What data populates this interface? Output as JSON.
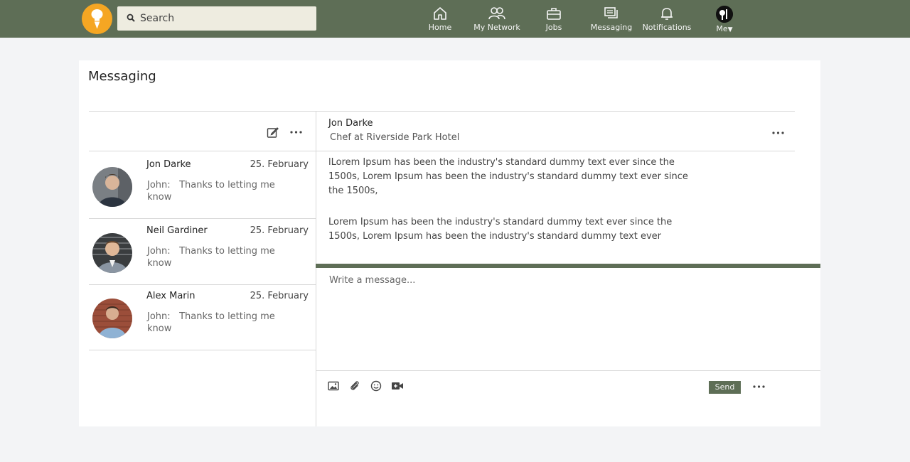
{
  "colors": {
    "accent": "#5e6e56",
    "logo": "#f5a623",
    "search_bg": "#eeece0"
  },
  "search": {
    "placeholder": "Search"
  },
  "nav": {
    "home": "Home",
    "network": "My Network",
    "jobs": "Jobs",
    "messaging": "Messaging",
    "notifications": "Notifications",
    "me": "Me"
  },
  "page": {
    "title": "Messaging"
  },
  "conversations": [
    {
      "name": "Jon Darke",
      "date": "25. February",
      "preview_sender": "John:",
      "preview_text": "Thanks to letting me know"
    },
    {
      "name": "Neil Gardiner",
      "date": "25. February",
      "preview_sender": "John:",
      "preview_text": "Thanks to letting me know"
    },
    {
      "name": "Alex Marin",
      "date": "25. February",
      "preview_sender": "John:",
      "preview_text": "Thanks to letting me know"
    }
  ],
  "chat": {
    "name": "Jon Darke",
    "subtitle": "Chef at Riverside Park Hotel",
    "messages": [
      "lLorem Ipsum has been the industry's standard dummy text ever since the 1500s,  Lorem Ipsum has been the industry's standard dummy text ever since the 1500s,",
      "Lorem Ipsum has been the industry's standard dummy text ever since the 1500s,  Lorem Ipsum has been the industry's standard dummy text ever"
    ],
    "compose_placeholder": "Write a message...",
    "send_label": "Send"
  },
  "icons": {
    "search": "search-icon",
    "home": "home-icon",
    "network": "people-icon",
    "jobs": "briefcase-icon",
    "messaging": "chat-icon",
    "notifications": "bell-icon",
    "compose": "edit-icon",
    "more": "more-horizontal-icon",
    "image": "image-icon",
    "attach": "paperclip-icon",
    "emoji": "smiley-icon",
    "video": "video-icon"
  }
}
